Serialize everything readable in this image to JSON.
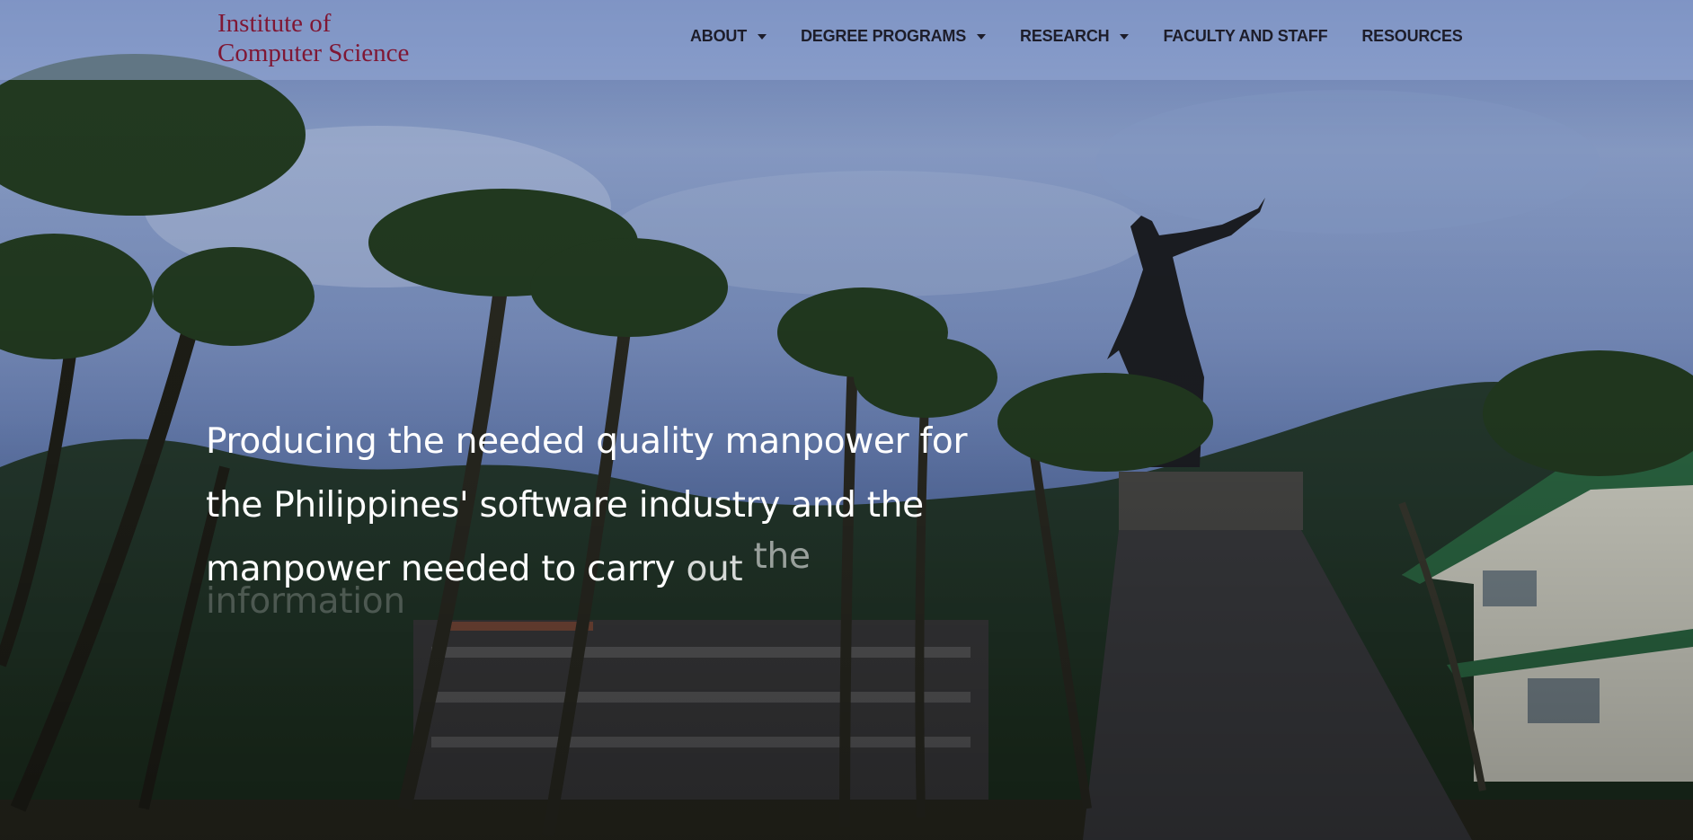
{
  "site": {
    "logo_line1": "Institute of",
    "logo_line2": "Computer Science",
    "logo_color": "#7f1734"
  },
  "nav": {
    "about": "ABOUT",
    "degree_programs": "DEGREE PROGRAMS",
    "research": "RESEARCH",
    "faculty_and_staff": "FACULTY AND STAFF",
    "resources": "RESOURCES"
  },
  "hero": {
    "line1": "Producing the needed quality manpower for",
    "line2": "the Philippines' software industry and the",
    "line3_a": "manpower needed to",
    "line3_b": "carry",
    "line3_c": "out",
    "line3_d": "the",
    "line4": "information"
  },
  "icons": {
    "dropdown": "chevron-down-icon"
  }
}
